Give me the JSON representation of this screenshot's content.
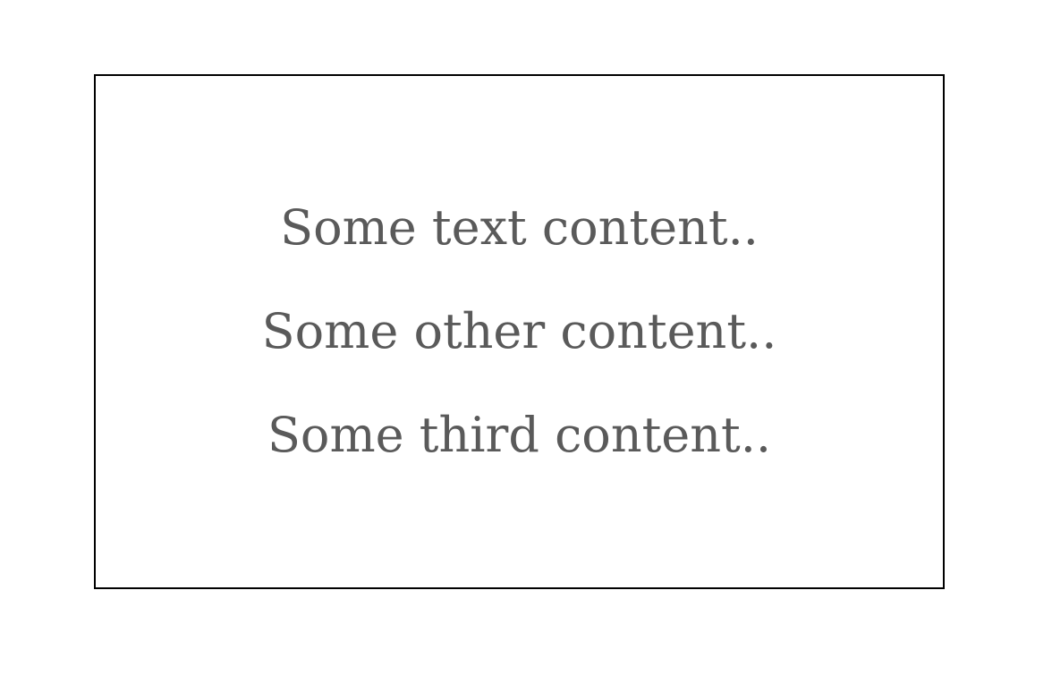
{
  "box": {
    "lines": [
      "Some text content..",
      "Some other content..",
      "Some third content.."
    ]
  },
  "colors": {
    "text": "#5a5a5a",
    "border": "#000000",
    "background": "#ffffff"
  }
}
